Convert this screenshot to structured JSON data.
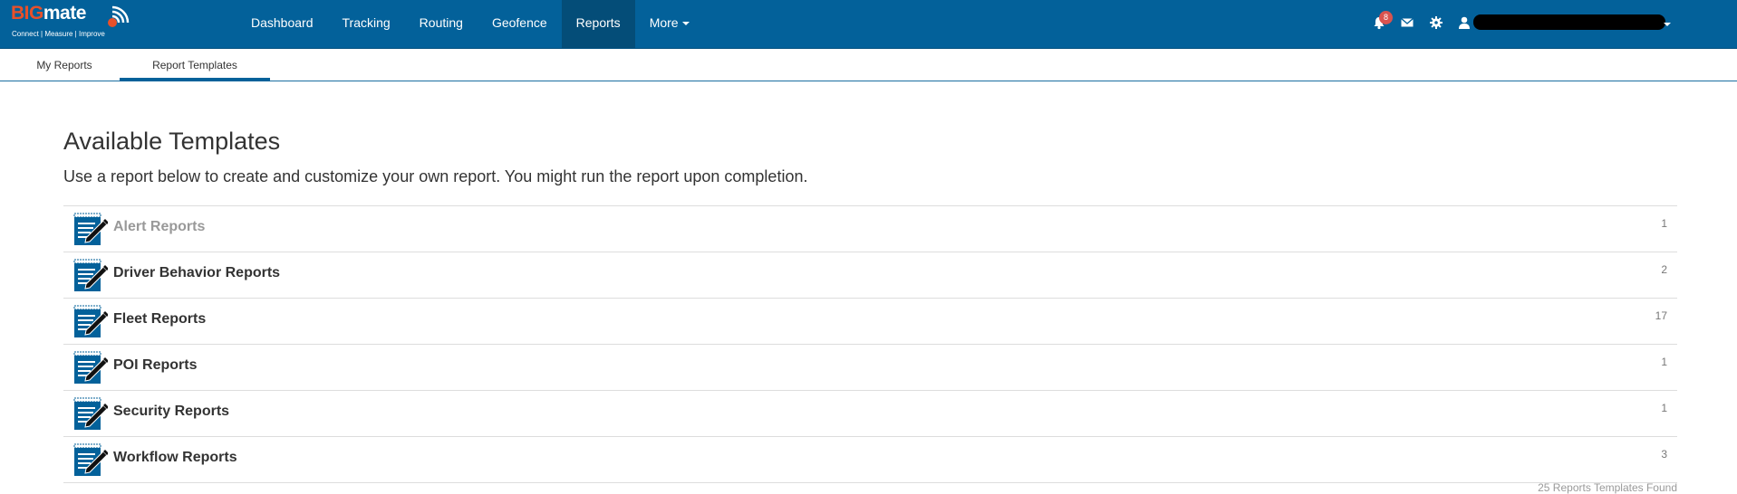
{
  "brand": {
    "name_part1": "BIG",
    "name_part2": "mate",
    "tagline": "Connect | Measure | Improve",
    "colors": {
      "navbar": "#03619a",
      "active_nav": "#044d78",
      "logo_accent": "#e8502a",
      "badge": "#d9534f"
    }
  },
  "nav": {
    "items": [
      {
        "label": "Dashboard",
        "active": false
      },
      {
        "label": "Tracking",
        "active": false
      },
      {
        "label": "Routing",
        "active": false
      },
      {
        "label": "Geofence",
        "active": false
      },
      {
        "label": "Reports",
        "active": true
      },
      {
        "label": "More",
        "active": false,
        "has_caret": true
      }
    ],
    "right": {
      "notifications_icon": "bell-icon",
      "notification_count": "8",
      "messages_icon": "envelope-icon",
      "settings_icon": "gear-icon",
      "user_icon": "user-icon"
    }
  },
  "subtabs": [
    {
      "label": "My Reports",
      "active": false
    },
    {
      "label": "Report Templates",
      "active": true
    }
  ],
  "main": {
    "title": "Available Templates",
    "subtitle": "Use a report below to create and customize your own report. You might run the report upon completion.",
    "templates": [
      {
        "label": "Alert Reports",
        "count": "1",
        "muted": true
      },
      {
        "label": "Driver Behavior Reports",
        "count": "2",
        "muted": false
      },
      {
        "label": "Fleet Reports",
        "count": "17",
        "muted": false
      },
      {
        "label": "POI Reports",
        "count": "1",
        "muted": false
      },
      {
        "label": "Security Reports",
        "count": "1",
        "muted": false
      },
      {
        "label": "Workflow Reports",
        "count": "3",
        "muted": false
      }
    ],
    "row_icon": "report-edit-icon",
    "found_text": "25 Reports Templates Found"
  }
}
